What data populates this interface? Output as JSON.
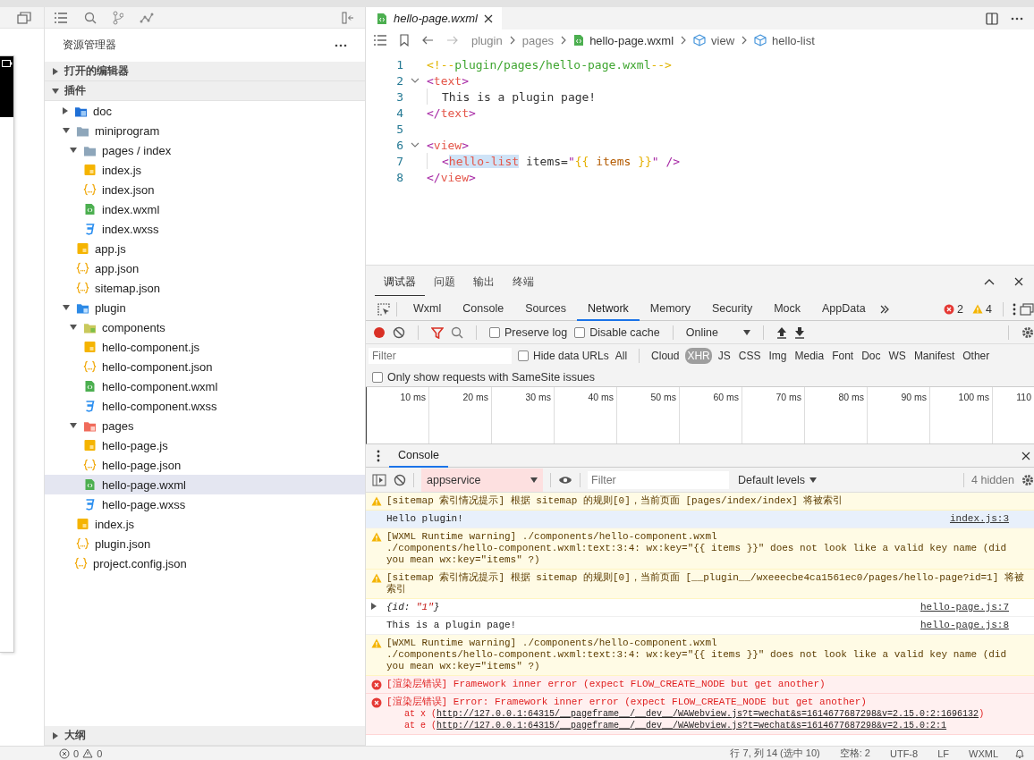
{
  "explorer": {
    "title": "资源管理器",
    "sections": [
      {
        "label": "打开的编辑器",
        "expanded": false
      },
      {
        "label": "插件",
        "expanded": true
      }
    ],
    "tree": [
      {
        "name": "doc",
        "kind": "docfolder",
        "expanded": false,
        "selected": false
      },
      {
        "name": "miniprogram",
        "kind": "folder",
        "expanded": true,
        "selected": false,
        "children": [
          {
            "name": "pages / index",
            "kind": "folder",
            "expanded": true,
            "selected": false,
            "children": [
              {
                "name": "index.js",
                "kind": "js",
                "selected": false
              },
              {
                "name": "index.json",
                "kind": "json",
                "selected": false
              },
              {
                "name": "index.wxml",
                "kind": "wxml",
                "selected": false
              },
              {
                "name": "index.wxss",
                "kind": "wxss",
                "selected": false
              }
            ]
          },
          {
            "name": "app.js",
            "kind": "js",
            "selected": false
          },
          {
            "name": "app.json",
            "kind": "json",
            "selected": false
          },
          {
            "name": "sitemap.json",
            "kind": "json",
            "selected": false
          }
        ]
      },
      {
        "name": "plugin",
        "kind": "pluginfolder",
        "expanded": true,
        "selected": false,
        "children": [
          {
            "name": "components",
            "kind": "compfolder",
            "expanded": true,
            "selected": false,
            "children": [
              {
                "name": "hello-component.js",
                "kind": "js",
                "selected": false
              },
              {
                "name": "hello-component.json",
                "kind": "json",
                "selected": false
              },
              {
                "name": "hello-component.wxml",
                "kind": "wxml",
                "selected": false
              },
              {
                "name": "hello-component.wxss",
                "kind": "wxss",
                "selected": false
              }
            ]
          },
          {
            "name": "pages",
            "kind": "pagesfolder",
            "expanded": true,
            "selected": false,
            "children": [
              {
                "name": "hello-page.js",
                "kind": "js",
                "selected": false
              },
              {
                "name": "hello-page.json",
                "kind": "json",
                "selected": false
              },
              {
                "name": "hello-page.wxml",
                "kind": "wxml",
                "selected": true
              },
              {
                "name": "hello-page.wxss",
                "kind": "wxss",
                "selected": false
              }
            ]
          },
          {
            "name": "index.js",
            "kind": "js",
            "selected": false
          },
          {
            "name": "plugin.json",
            "kind": "json",
            "selected": false
          }
        ]
      },
      {
        "name": "project.config.json",
        "kind": "json",
        "selected": false
      }
    ],
    "outline": {
      "label": "大纲",
      "expanded": false
    }
  },
  "editor": {
    "tabs": [
      {
        "label": "hello-page.wxml",
        "selected": true
      }
    ],
    "breadcrumb": [
      {
        "label": "plugin",
        "kind": "folder"
      },
      {
        "label": "pages",
        "kind": "folder"
      },
      {
        "label": "hello-page.wxml",
        "kind": "file"
      },
      {
        "label": "view",
        "kind": "element"
      },
      {
        "label": "hello-list",
        "kind": "element"
      }
    ],
    "lines": [
      {
        "number": "1",
        "fold": false,
        "indented": false,
        "tokens": [
          {
            "text": "<!--",
            "kind": "punct"
          },
          {
            "text": "plugin/pages/hello-page.wxml",
            "kind": "comment"
          },
          {
            "text": "-->",
            "kind": "punct"
          }
        ]
      },
      {
        "number": "2",
        "fold": true,
        "indented": false,
        "tokens": [
          {
            "text": "<",
            "kind": "bracket"
          },
          {
            "text": "text",
            "kind": "tag"
          },
          {
            "text": ">",
            "kind": "bracket"
          }
        ]
      },
      {
        "number": "3",
        "fold": false,
        "indented": true,
        "tokens": [
          {
            "text": "This is a plugin page!",
            "kind": "plain"
          }
        ]
      },
      {
        "number": "4",
        "fold": false,
        "indented": false,
        "tokens": [
          {
            "text": "</",
            "kind": "bracket"
          },
          {
            "text": "text",
            "kind": "tag"
          },
          {
            "text": ">",
            "kind": "bracket"
          }
        ]
      },
      {
        "number": "5",
        "fold": false,
        "indented": false
      },
      {
        "number": "6",
        "fold": true,
        "indented": false,
        "tokens": [
          {
            "text": "<",
            "kind": "bracket"
          },
          {
            "text": "view",
            "kind": "tag"
          },
          {
            "text": ">",
            "kind": "bracket"
          }
        ]
      },
      {
        "number": "7",
        "fold": false,
        "indented": true,
        "tokens": [
          {
            "text": "<",
            "kind": "bracket"
          },
          {
            "text": "hello-list",
            "kind": "tag",
            "highlight": true
          },
          {
            "text": " items=",
            "kind": "plain"
          },
          {
            "text": "\"",
            "kind": "bracket"
          },
          {
            "text": "{{",
            "kind": "brace"
          },
          {
            "text": " items ",
            "kind": "var"
          },
          {
            "text": "}}",
            "kind": "brace"
          },
          {
            "text": "\" />",
            "kind": "bracket"
          }
        ]
      },
      {
        "number": "8",
        "fold": false,
        "indented": false,
        "tokens": [
          {
            "text": "</",
            "kind": "bracket"
          },
          {
            "text": "view",
            "kind": "tag"
          },
          {
            "text": ">",
            "kind": "bracket"
          }
        ]
      }
    ]
  },
  "devtools": {
    "panels": [
      {
        "label": "调试器",
        "selected": true
      },
      {
        "label": "问题",
        "selected": false
      },
      {
        "label": "输出",
        "selected": false
      },
      {
        "label": "终端",
        "selected": false
      }
    ],
    "tools": [
      {
        "label": "Wxml",
        "selected": false
      },
      {
        "label": "Console",
        "selected": false
      },
      {
        "label": "Sources",
        "selected": false
      },
      {
        "label": "Network",
        "selected": true
      },
      {
        "label": "Memory",
        "selected": false
      },
      {
        "label": "Security",
        "selected": false
      },
      {
        "label": "Mock",
        "selected": false
      },
      {
        "label": "AppData",
        "selected": false
      }
    ],
    "error_count": "2",
    "warning_count": "4",
    "network": {
      "preserve_log": {
        "label": "Preserve log",
        "checked": false
      },
      "disable_cache": {
        "label": "Disable cache",
        "checked": false
      },
      "throttling": "Online",
      "filter": {
        "placeholder": "Filter"
      },
      "hide_data_urls": {
        "label": "Hide data URLs",
        "checked": false
      },
      "types": [
        {
          "label": "All",
          "selected": false
        },
        {
          "label": "Cloud",
          "selected": false
        },
        {
          "label": "XHR",
          "selected": true
        },
        {
          "label": "JS",
          "selected": false
        },
        {
          "label": "CSS",
          "selected": false
        },
        {
          "label": "Img",
          "selected": false
        },
        {
          "label": "Media",
          "selected": false
        },
        {
          "label": "Font",
          "selected": false
        },
        {
          "label": "Doc",
          "selected": false
        },
        {
          "label": "WS",
          "selected": false
        },
        {
          "label": "Manifest",
          "selected": false
        },
        {
          "label": "Other",
          "selected": false
        }
      ],
      "samesite": {
        "label": "Only show requests with SameSite issues",
        "checked": false
      },
      "ticks": [
        "10 ms",
        "20 ms",
        "30 ms",
        "40 ms",
        "50 ms",
        "60 ms",
        "70 ms",
        "80 ms",
        "90 ms",
        "100 ms",
        "110"
      ]
    },
    "console": {
      "tab": "Console",
      "context": "appservice",
      "filter": {
        "placeholder": "Filter"
      },
      "levels": "Default levels",
      "hidden": "4 hidden",
      "messages": [
        {
          "kind": "warning",
          "text": "[sitemap 索引情况提示] 根据 sitemap 的规则[0]，当前页面 [pages/index/index] 将被索引",
          "selected": false
        },
        {
          "kind": "log",
          "text": "Hello plugin!",
          "source": "index.js:3",
          "selected": true
        },
        {
          "kind": "warning",
          "text": "[WXML Runtime warning] ./components/hello-component.wxml\n./components/hello-component.wxml:text:3:4: wx:key=\"{{ items }}\" does not look like a valid key name (did you mean wx:key=\"items\" ?)",
          "selected": false
        },
        {
          "kind": "warning",
          "text": "[sitemap 索引情况提示] 根据 sitemap 的规则[0]，当前页面 [__plugin__/wxeeecbe4ca1561ec0/pages/hello-page?id=1] 将被索引",
          "selected": false
        },
        {
          "kind": "object",
          "prefix": "{id: ",
          "value": "\"1\"",
          "suffix": "}",
          "expanded": false,
          "source": "hello-page.js:7",
          "selected": false
        },
        {
          "kind": "log",
          "text": "This is a plugin page!",
          "source": "hello-page.js:8",
          "selected": false
        },
        {
          "kind": "warning",
          "text": "[WXML Runtime warning] ./components/hello-component.wxml\n./components/hello-component.wxml:text:3:4: wx:key=\"{{ items }}\" does not look like a valid key name (did you mean wx:key=\"items\" ?)",
          "selected": false
        },
        {
          "kind": "error",
          "text": "[渲染层错误] Framework inner error (expect FLOW_CREATE_NODE but get another)",
          "selected": false
        },
        {
          "kind": "error",
          "text": "[渲染层错误] Error: Framework inner error (expect FLOW_CREATE_NODE but get another)",
          "selected": false,
          "stack": [
            {
              "call": "at x (",
              "url": "http://127.0.0.1:64315/__pageframe__/__dev__/WAWebview.js?t=wechat&s=1614677687298&v=2.15.0:2:1696132",
              "end": ")"
            },
            {
              "call": "at e (",
              "url": "http://127.0.0.1:64315/__pageframe__/__dev__/WAWebview.js?t=wechat&s=1614677687298&v=2.15.0:2:1"
            }
          ]
        }
      ]
    }
  },
  "status_bar": {
    "errors": "0",
    "warnings": "0",
    "items": [
      "行 7, 列 14 (选中 10)",
      "空格: 2",
      "UTF-8",
      "LF",
      "WXML"
    ]
  }
}
